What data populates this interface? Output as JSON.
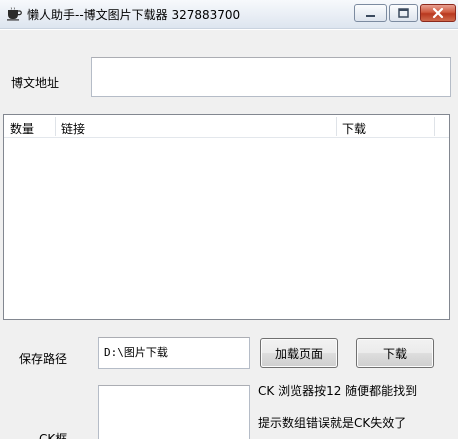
{
  "window": {
    "title": "懒人助手--博文图片下载器  327883700",
    "controls": {
      "minimize_icon": "minimize-icon",
      "maximize_icon": "maximize-icon",
      "close_icon": "close-icon"
    }
  },
  "blog_url": {
    "label": "博文地址",
    "value": ""
  },
  "list": {
    "columns": [
      "数量",
      "链接",
      "下载"
    ],
    "rows": []
  },
  "save_path": {
    "label": "保存路径",
    "value": "D:\\图片下载"
  },
  "buttons": {
    "load_page": "加载页面",
    "download": "下载"
  },
  "ck": {
    "label": "CK框",
    "value": "",
    "hint1": "CK 浏览器按12 随便都能找到",
    "hint2": "提示数组错误就是CK失效了"
  },
  "colors": {
    "accent": "#c74a30",
    "window_bg": "#f0f0f0",
    "border": "#828790"
  }
}
